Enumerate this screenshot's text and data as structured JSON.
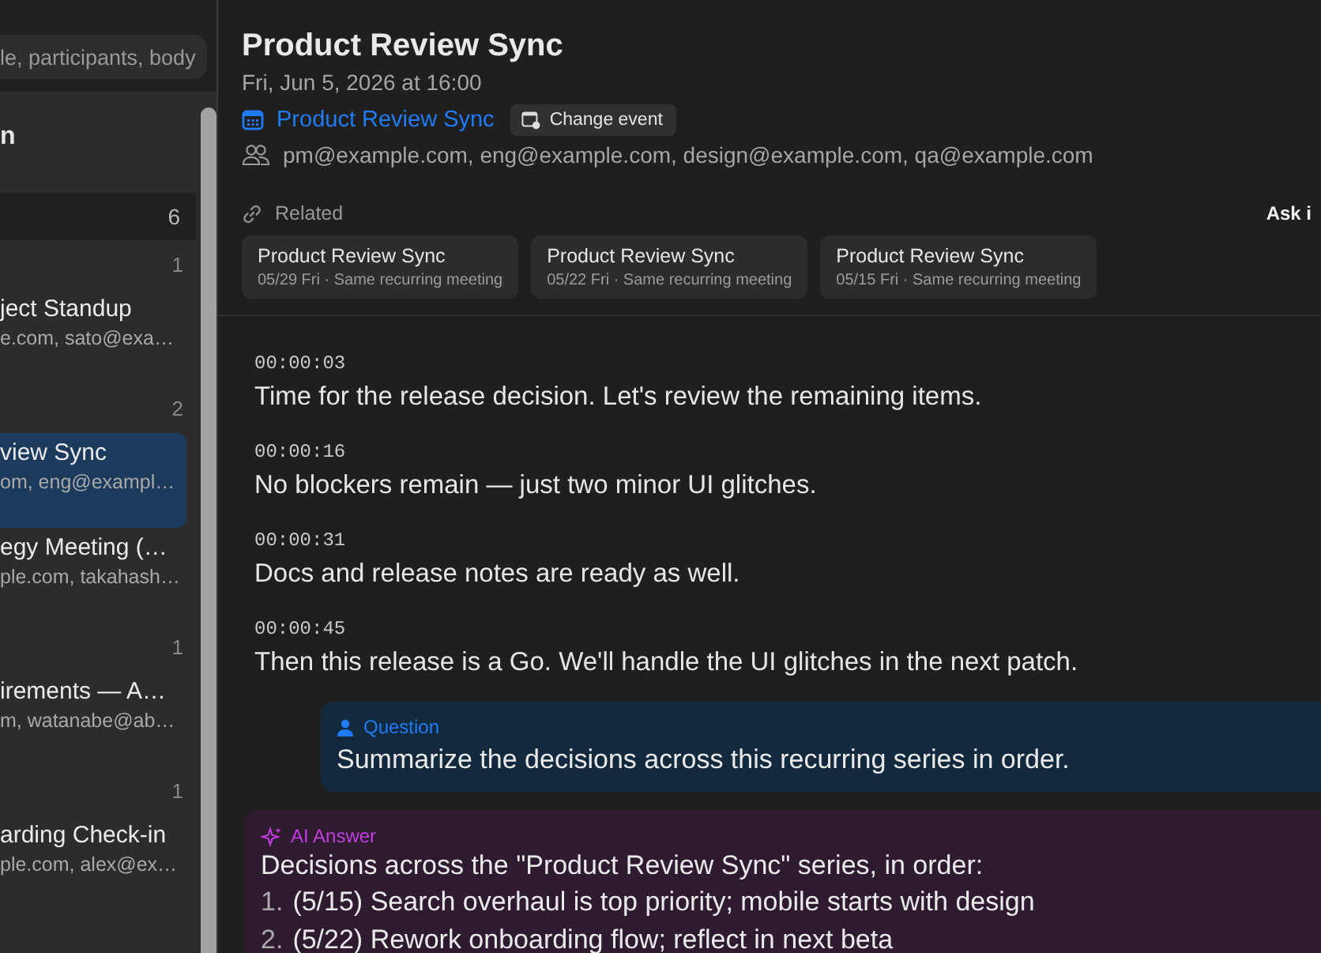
{
  "search": {
    "placeholder": "le, participants, body"
  },
  "sidebar": {
    "heading": "n",
    "group": {
      "count": "6"
    },
    "items": [
      {
        "kind": "count",
        "text": "1"
      },
      {
        "kind": "meeting",
        "title": "ject Standup",
        "participants": "e.com, sato@exa…",
        "selected": false
      },
      {
        "kind": "count",
        "text": "2"
      },
      {
        "kind": "meeting",
        "title": "view Sync",
        "participants": "om, eng@exampl…",
        "selected": true
      },
      {
        "kind": "meeting",
        "title": "egy Meeting (…",
        "participants": "ple.com, takahash…",
        "selected": false
      },
      {
        "kind": "count",
        "text": "1"
      },
      {
        "kind": "meeting",
        "title": "irements — A…",
        "participants": "m, watanabe@ab…",
        "selected": false
      },
      {
        "kind": "count",
        "text": "1"
      },
      {
        "kind": "meeting",
        "title": "arding Check-in",
        "participants": "ple.com, alex@ex…",
        "selected": false
      }
    ]
  },
  "event": {
    "title": "Product Review Sync",
    "datetime": "Fri, Jun 5, 2026 at 16:00",
    "calendar_link": "Product Review Sync",
    "change_button": "Change event",
    "participants": "pm@example.com, eng@example.com, design@example.com, qa@example.com"
  },
  "related": {
    "label": "Related",
    "ask": "Ask i",
    "items": [
      {
        "title": "Product Review Sync",
        "meta": "05/29 Fri · Same recurring meeting"
      },
      {
        "title": "Product Review Sync",
        "meta": "05/22 Fri · Same recurring meeting"
      },
      {
        "title": "Product Review Sync",
        "meta": "05/15 Fri · Same recurring meeting"
      }
    ]
  },
  "transcript": [
    {
      "time": "00:00:03",
      "text": "Time for the release decision. Let's review the remaining items."
    },
    {
      "time": "00:00:16",
      "text": "No blockers remain — just two minor UI glitches."
    },
    {
      "time": "00:00:31",
      "text": "Docs and release notes are ready as well."
    },
    {
      "time": "00:00:45",
      "text": "Then this release is a Go. We'll handle the UI glitches in the next patch."
    }
  ],
  "question": {
    "label": "Question",
    "text": "Summarize the decisions across this recurring series in order."
  },
  "answer": {
    "label": "AI Answer",
    "intro": "Decisions across the \"Product Review Sync\" series, in order:",
    "items": [
      {
        "number": "1.",
        "text": "(5/15) Search overhaul is top priority; mobile starts with design"
      },
      {
        "number": "2.",
        "text": "(5/22) Rework onboarding flow; reflect in next beta"
      }
    ]
  }
}
